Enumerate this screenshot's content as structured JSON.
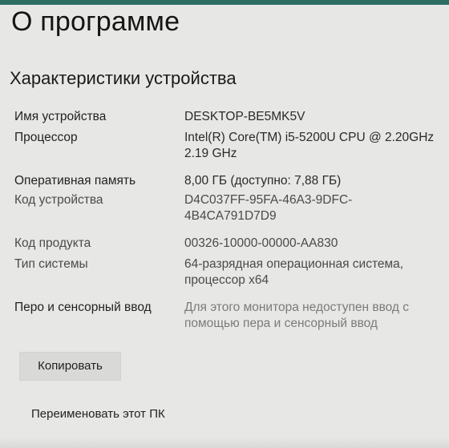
{
  "page": {
    "title": "О программе",
    "section_title": "Характеристики устройства"
  },
  "specs": [
    {
      "label": "Имя устройства",
      "value": "DESKTOP-BE5MK5V"
    },
    {
      "label": "Процессор",
      "value": "Intel(R) Core(TM) i5-5200U CPU @ 2.20GHz 2.19 GHz"
    },
    {
      "label": "Оперативная память",
      "value": "8,00 ГБ (доступно: 7,88 ГБ)"
    },
    {
      "label": "Код устройства",
      "value": "D4C037FF-95FA-46A3-9DFC-4B4CA791D7D9"
    },
    {
      "label": "Код продукта",
      "value": "00326-10000-00000-AA830"
    },
    {
      "label": "Тип системы",
      "value": "64-разрядная операционная система, процессор x64"
    },
    {
      "label": "Перо и сенсорный ввод",
      "value": "Для этого монитора недоступен ввод с помощью пера и сенсорный ввод"
    }
  ],
  "buttons": {
    "copy": "Копировать",
    "rename": "Переименовать этот ПК"
  },
  "colors": {
    "background": "#e7e7e6",
    "accent": "#2f6f63",
    "button": "#d9d9d8"
  }
}
